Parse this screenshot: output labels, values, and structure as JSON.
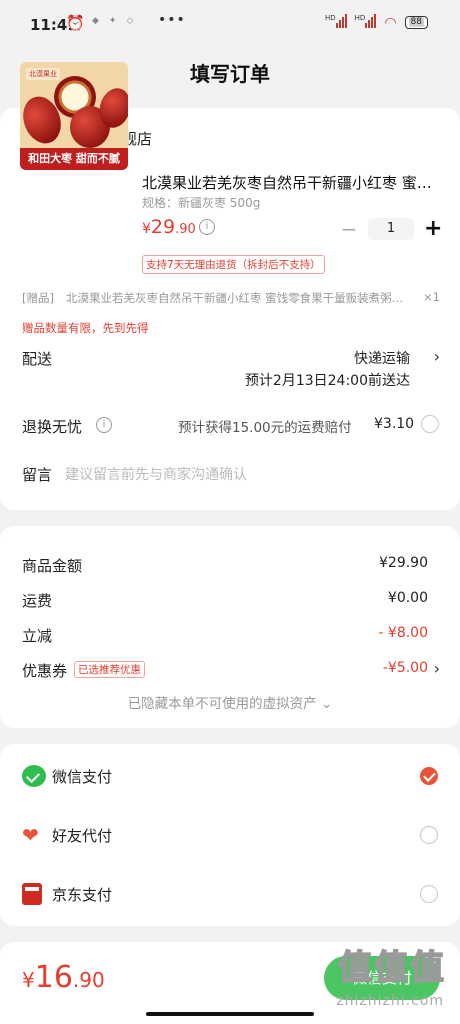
{
  "status": {
    "time": "11:41",
    "battery": "88",
    "signal1": "HD",
    "signal2": "HD"
  },
  "nav": {
    "title": "填写订单"
  },
  "shop": {
    "name": "城南堡花旗舰店"
  },
  "product": {
    "thumb_logo": "北漠果业",
    "thumb_banner": "和田大枣 甜而不腻",
    "title": "北漠果业若羌灰枣自然吊干新疆小红枣 蜜…",
    "spec": "规格：新疆灰枣 500g",
    "price_symbol": "¥",
    "price_int": "29",
    "price_dec": ".90",
    "qty": "1",
    "minus": "−",
    "plus": "+",
    "refund_tag": "支持7天无理由退货（拆封后不支持）"
  },
  "gift": {
    "tag": "[赠品]",
    "text": "北漠果业若羌灰枣自然吊干新疆小红枣 蜜饯零食果干量贩装煮粥…",
    "qty": "×1",
    "note": "赠品数量有限，先到先得"
  },
  "delivery": {
    "label": "配送",
    "method": "快递运输",
    "eta": "预计2月13日24:00前送达"
  },
  "return": {
    "label": "退换无忧",
    "text": "预计获得15.00元的运费赔付",
    "price": "¥3.10"
  },
  "message": {
    "label": "留言",
    "placeholder": "建议留言前先与商家沟通确认"
  },
  "summary": {
    "goods_label": "商品金额",
    "goods_value": "¥29.90",
    "shipping_label": "运费",
    "shipping_value": "¥0.00",
    "discount_label": "立减",
    "discount_value": "- ¥8.00",
    "coupon_label": "优惠券",
    "coupon_tag": "已选推荐优惠",
    "coupon_value": "-¥5.00",
    "hidden_assets": "已隐藏本单不可使用的虚拟资产 ⌄"
  },
  "payment": {
    "methods": [
      {
        "label": "微信支付",
        "icon": "wechat-pay-icon",
        "selected": true
      },
      {
        "label": "好友代付",
        "icon": "friend-pay-icon",
        "selected": false
      },
      {
        "label": "京东支付",
        "icon": "jd-pay-icon",
        "selected": false
      }
    ]
  },
  "footer": {
    "total_symbol": "¥",
    "total_int": "16",
    "total_dec": ".90",
    "pay_button": "微信支付",
    "watermark": "值值值",
    "watermark_url": "zhizhizhi.com"
  },
  "colors": {
    "accent": "#e53d2f",
    "wechat": "#2dbe4e",
    "background": "#f2f2f2"
  }
}
